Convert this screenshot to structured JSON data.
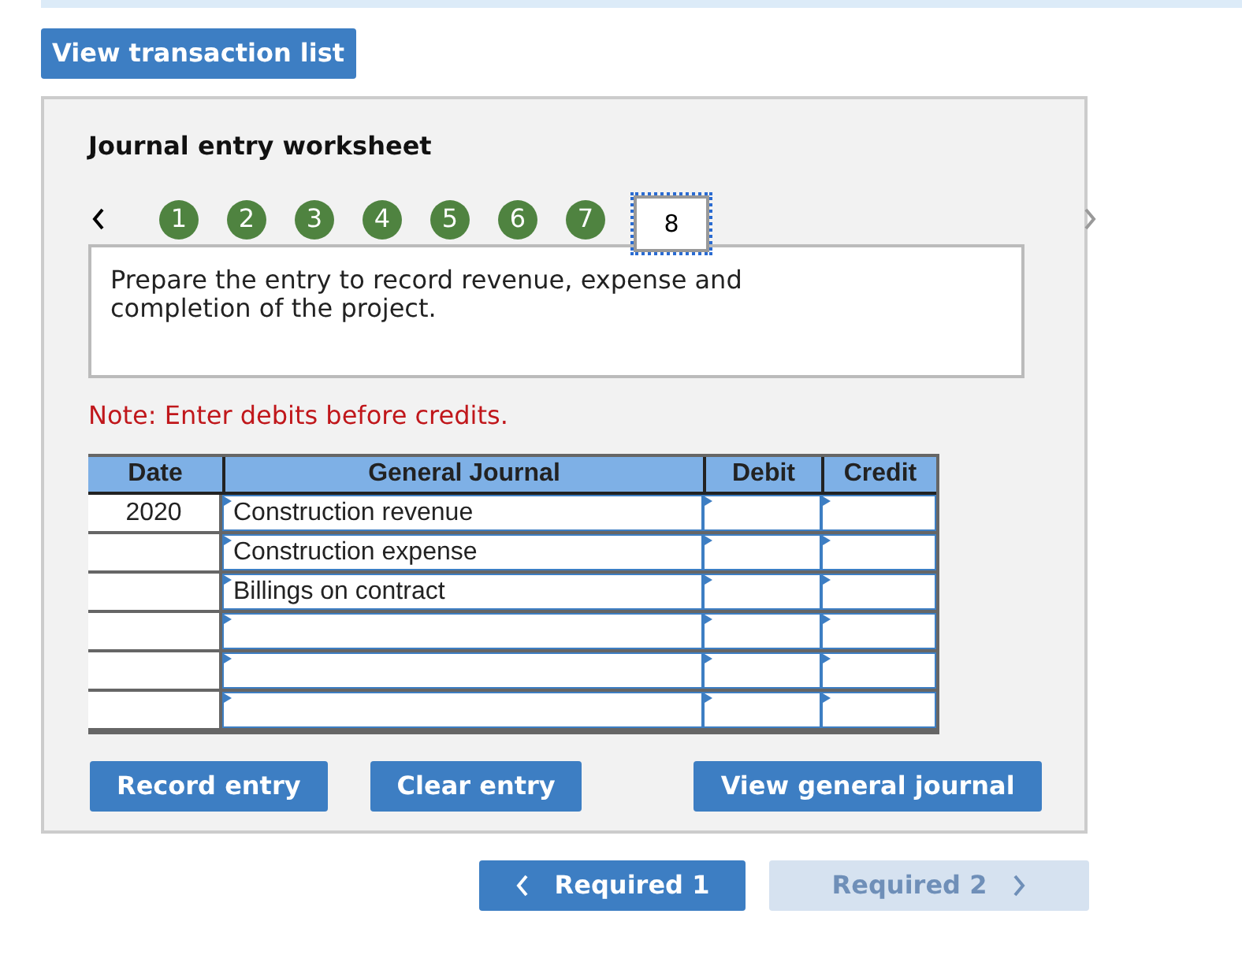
{
  "top_button": "View transaction list",
  "worksheet": {
    "title": "Journal entry worksheet",
    "steps": [
      {
        "label": "1",
        "done": true,
        "selected": false
      },
      {
        "label": "2",
        "done": true,
        "selected": false
      },
      {
        "label": "3",
        "done": true,
        "selected": false
      },
      {
        "label": "4",
        "done": true,
        "selected": false
      },
      {
        "label": "5",
        "done": true,
        "selected": false
      },
      {
        "label": "6",
        "done": true,
        "selected": false
      },
      {
        "label": "7",
        "done": true,
        "selected": false
      },
      {
        "label": "8",
        "done": false,
        "selected": true
      }
    ],
    "prev_disabled": false,
    "next_disabled": true,
    "prompt": "Prepare the entry to record revenue, expense and completion of the project.",
    "note": "Note: Enter debits before credits.",
    "table": {
      "columns": [
        "Date",
        "General Journal",
        "Debit",
        "Credit"
      ],
      "rows": [
        {
          "date": "2020",
          "account": "Construction revenue"
        },
        {
          "account": "Construction expense"
        },
        {
          "account": "Billings on contract"
        },
        {},
        {},
        {}
      ]
    },
    "buttons": [
      "Record entry",
      "Clear entry",
      "View general journal"
    ]
  },
  "nav": [
    {
      "label": "Required 1",
      "kind": "prev",
      "disabled": false
    },
    {
      "label": "Required 2",
      "kind": "next",
      "disabled": true
    }
  ]
}
